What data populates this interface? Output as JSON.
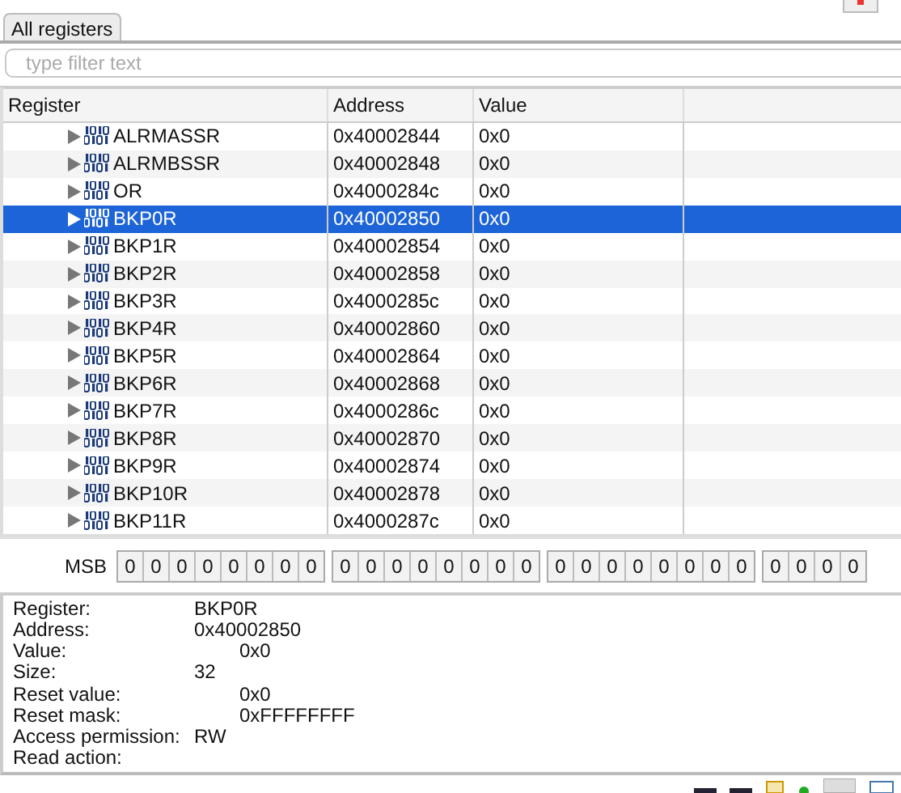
{
  "tabs": [
    {
      "label": "All registers",
      "selected": true
    }
  ],
  "filter": {
    "placeholder": "type filter text"
  },
  "table": {
    "columns": [
      "Register",
      "Address",
      "Value"
    ],
    "rows": [
      {
        "name": "ALRMASSR",
        "address": "0x40002844",
        "value": "0x0",
        "selected": false
      },
      {
        "name": "ALRMBSSR",
        "address": "0x40002848",
        "value": "0x0",
        "selected": false
      },
      {
        "name": "OR",
        "address": "0x4000284c",
        "value": "0x0",
        "selected": false
      },
      {
        "name": "BKP0R",
        "address": "0x40002850",
        "value": "0x0",
        "selected": true
      },
      {
        "name": "BKP1R",
        "address": "0x40002854",
        "value": "0x0",
        "selected": false
      },
      {
        "name": "BKP2R",
        "address": "0x40002858",
        "value": "0x0",
        "selected": false
      },
      {
        "name": "BKP3R",
        "address": "0x4000285c",
        "value": "0x0",
        "selected": false
      },
      {
        "name": "BKP4R",
        "address": "0x40002860",
        "value": "0x0",
        "selected": false
      },
      {
        "name": "BKP5R",
        "address": "0x40002864",
        "value": "0x0",
        "selected": false
      },
      {
        "name": "BKP6R",
        "address": "0x40002868",
        "value": "0x0",
        "selected": false
      },
      {
        "name": "BKP7R",
        "address": "0x4000286c",
        "value": "0x0",
        "selected": false
      },
      {
        "name": "BKP8R",
        "address": "0x40002870",
        "value": "0x0",
        "selected": false
      },
      {
        "name": "BKP9R",
        "address": "0x40002874",
        "value": "0x0",
        "selected": false
      },
      {
        "name": "BKP10R",
        "address": "0x40002878",
        "value": "0x0",
        "selected": false
      },
      {
        "name": "BKP11R",
        "address": "0x4000287c",
        "value": "0x0",
        "selected": false
      }
    ]
  },
  "bits": {
    "label": "MSB",
    "groups": [
      [
        "0",
        "0",
        "0",
        "0",
        "0",
        "0",
        "0",
        "0"
      ],
      [
        "0",
        "0",
        "0",
        "0",
        "0",
        "0",
        "0",
        "0"
      ],
      [
        "0",
        "0",
        "0",
        "0",
        "0",
        "0",
        "0",
        "0"
      ],
      [
        "0",
        "0",
        "0",
        "0"
      ]
    ]
  },
  "details": [
    {
      "label": "Register:",
      "value": "BKP0R",
      "indented": false
    },
    {
      "label": "Address:",
      "value": "0x40002850",
      "indented": false
    },
    {
      "label": "Value:",
      "value": "0x0",
      "indented": true
    },
    {
      "label": "Size:",
      "value": "32",
      "indented": false
    },
    {
      "label": "Reset value:",
      "value": "0x0",
      "indented": true
    },
    {
      "label": "Reset mask:",
      "value": "0xFFFFFFFF",
      "indented": true
    },
    {
      "label": "Access permission:",
      "value": "RW",
      "indented": false
    },
    {
      "label": "Read action:"
    }
  ]
}
